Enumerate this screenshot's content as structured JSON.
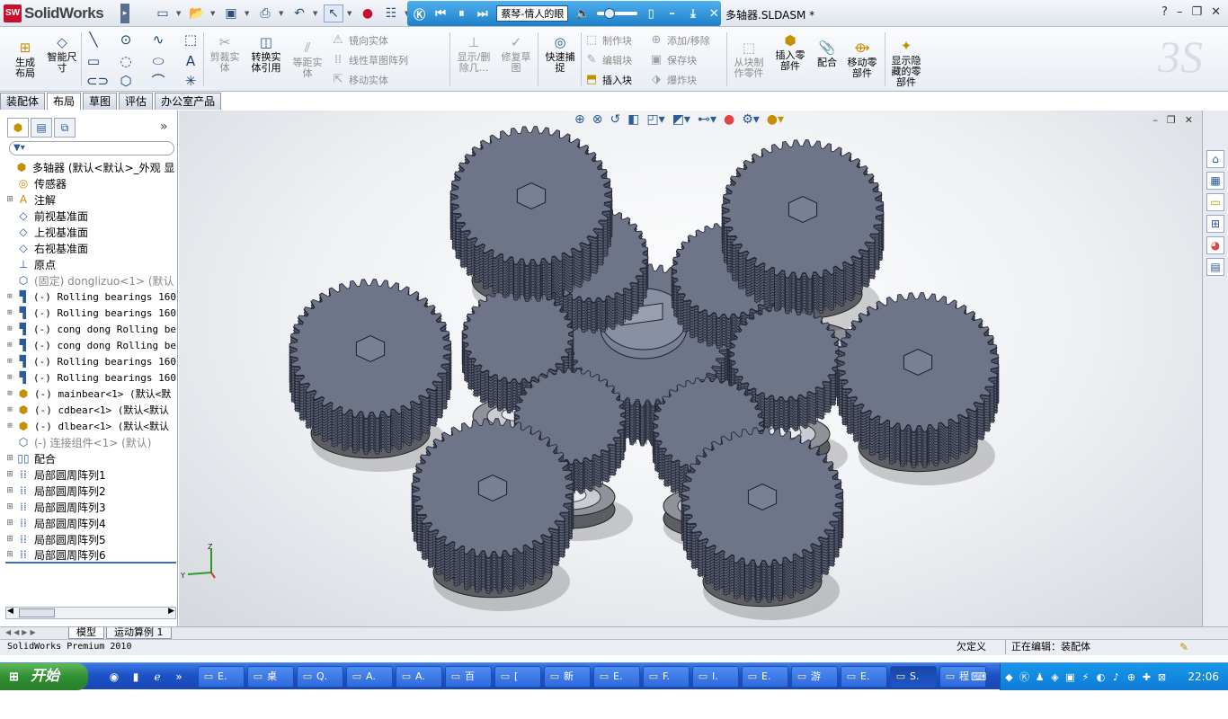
{
  "app": {
    "logo_badge": "SW",
    "logo_text": "SolidWorks",
    "document_title": "多轴器.SLDASM *"
  },
  "quick_tools": [
    "new-icon",
    "open-icon",
    "save-icon",
    "print-icon",
    "undo-icon",
    "select-icon",
    "rebuild-icon",
    "options-icon"
  ],
  "media_player": {
    "song": "蔡琴-情人的眼"
  },
  "window_controls": {
    "help": "?",
    "minimize": "–",
    "restore": "❐",
    "close": "✕"
  },
  "ribbon": {
    "generate_layout": "生成\n布局",
    "smart_dimension": "智能尺\n寸",
    "trim": "剪裁实\n体",
    "convert": "转换实\n体引用",
    "offset": "等距实\n体",
    "mirror": "镜向实体",
    "linear_pattern": "线性草图阵列",
    "move": "移动实体",
    "show_delete": "显示/删\n除几...",
    "repair": "修复草\n图",
    "quick_snap": "快速捕\n捉",
    "make_block": "制作块",
    "edit_block": "编辑块",
    "insert_block": "插入块",
    "add_remove": "添加/移除",
    "save_block": "保存块",
    "explode_block": "爆炸块",
    "make_part": "从块制\n作零件",
    "insert_component": "插入零\n部件",
    "mate": "配合",
    "move_component": "移动零\n部件",
    "show_hidden": "显示隐\n藏的零\n部件"
  },
  "tabs": [
    "装配体",
    "布局",
    "草图",
    "评估",
    "办公室产品"
  ],
  "active_tab": "布局",
  "feature_manager": {
    "expand": "»",
    "filter_icon": "filter-icon",
    "tree": [
      {
        "label": "多轴器  (默认<默认>_外观 显",
        "icon": "assembly-icon",
        "expander": "",
        "style": "root"
      },
      {
        "label": "传感器",
        "icon": "sensor-icon",
        "expander": "",
        "style": "indent"
      },
      {
        "label": "注解",
        "icon": "annotation-icon",
        "expander": "⊞",
        "style": "indent"
      },
      {
        "label": "前视基准面",
        "icon": "plane-icon",
        "expander": "",
        "style": "indent"
      },
      {
        "label": "上视基准面",
        "icon": "plane-icon",
        "expander": "",
        "style": "indent"
      },
      {
        "label": "右视基准面",
        "icon": "plane-icon",
        "expander": "",
        "style": "indent"
      },
      {
        "label": "原点",
        "icon": "origin-icon",
        "expander": "",
        "style": "indent"
      },
      {
        "label": "(固定) donglizuo<1> (默认",
        "icon": "part-icon",
        "expander": "",
        "style": "gray"
      },
      {
        "label": "(-) Rolling bearings 160",
        "icon": "bearing-icon",
        "expander": "⊞",
        "style": "mono"
      },
      {
        "label": "(-) Rolling bearings 160",
        "icon": "bearing-icon",
        "expander": "⊞",
        "style": "mono"
      },
      {
        "label": "(-) cong dong Rolling be",
        "icon": "bearing-icon",
        "expander": "⊞",
        "style": "mono"
      },
      {
        "label": "(-) cong dong Rolling be",
        "icon": "bearing-icon",
        "expander": "⊞",
        "style": "mono"
      },
      {
        "label": "(-) Rolling bearings 160",
        "icon": "bearing-icon",
        "expander": "⊞",
        "style": "mono"
      },
      {
        "label": "(-) Rolling bearings 160",
        "icon": "bearing-icon",
        "expander": "⊞",
        "style": "mono"
      },
      {
        "label": "(-) mainbear<1> (默认<默",
        "icon": "subassembly-icon",
        "expander": "⊞",
        "style": "mono"
      },
      {
        "label": "(-) cdbear<1> (默认<默认",
        "icon": "subassembly-icon",
        "expander": "⊞",
        "style": "mono"
      },
      {
        "label": "(-) dlbear<1> (默认<默认",
        "icon": "subassembly-icon",
        "expander": "⊞",
        "style": "mono"
      },
      {
        "label": "(-) 连接组件<1> (默认)",
        "icon": "part-icon",
        "expander": "",
        "style": "gray"
      },
      {
        "label": "配合",
        "icon": "mates-icon",
        "expander": "⊞",
        "style": "indent"
      },
      {
        "label": "局部圆周阵列1",
        "icon": "pattern-icon",
        "expander": "⊞",
        "style": "indent"
      },
      {
        "label": "局部圆周阵列2",
        "icon": "pattern-icon",
        "expander": "⊞",
        "style": "indent"
      },
      {
        "label": "局部圆周阵列3",
        "icon": "pattern-icon",
        "expander": "⊞",
        "style": "indent"
      },
      {
        "label": "局部圆周阵列4",
        "icon": "pattern-icon",
        "expander": "⊞",
        "style": "indent"
      },
      {
        "label": "局部圆周阵列5",
        "icon": "pattern-icon",
        "expander": "⊞",
        "style": "indent"
      },
      {
        "label": "局部圆周阵列6",
        "icon": "pattern-icon",
        "expander": "⊞",
        "style": "sel"
      }
    ]
  },
  "triad": {
    "z": "Z",
    "y": "Y"
  },
  "bottom_tabs": [
    "模型",
    "运动算例 1"
  ],
  "active_bottom_tab": "模型",
  "status": {
    "product": "SolidWorks Premium 2010",
    "definition": "欠定义",
    "editing": "正在编辑：装配体"
  },
  "taskbar": {
    "start": "开始",
    "tasks": [
      "E.",
      "桌",
      "Q.",
      "A.",
      "A.",
      "百",
      "[",
      "新",
      "E.",
      "F.",
      "I.",
      "E.",
      "游",
      "E.",
      "S.",
      "程"
    ],
    "active_task": 14,
    "clock": "22:06"
  }
}
